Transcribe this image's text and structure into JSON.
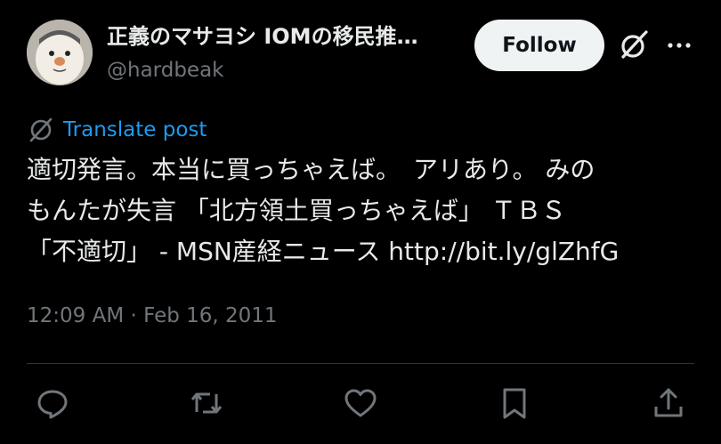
{
  "author": {
    "display_name": "正義のマサヨシ IOMの移民推…",
    "handle": "@hardbeak",
    "avatar_icon": "cartoon-face-avatar"
  },
  "header": {
    "follow_label": "Follow",
    "grok_icon": "grok-icon",
    "more_icon": "more-icon"
  },
  "translate": {
    "icon": "globe-icon",
    "label": "Translate post"
  },
  "post": {
    "lines": [
      "適切発言。本当に買っちゃえば。　アリあり。 みの",
      "もんたが失言 「北方領土買っちゃえば」 ＴＢＳ",
      "「不適切」 - MSN産経ニュース "
    ],
    "link": "http://bit.ly/glZhfG"
  },
  "timestamp": "12:09 AM · Feb 16, 2011",
  "actions": [
    {
      "name": "reply",
      "icon": "reply-icon"
    },
    {
      "name": "repost",
      "icon": "repost-icon"
    },
    {
      "name": "like",
      "icon": "like-icon"
    },
    {
      "name": "bookmark",
      "icon": "bookmark-icon"
    },
    {
      "name": "share",
      "icon": "share-icon"
    }
  ],
  "colors": {
    "background": "#000000",
    "text": "#e7e9ea",
    "muted": "#71767b",
    "link": "#1d9bf0",
    "button_bg": "#eff3f4",
    "divider": "#2f3336"
  }
}
